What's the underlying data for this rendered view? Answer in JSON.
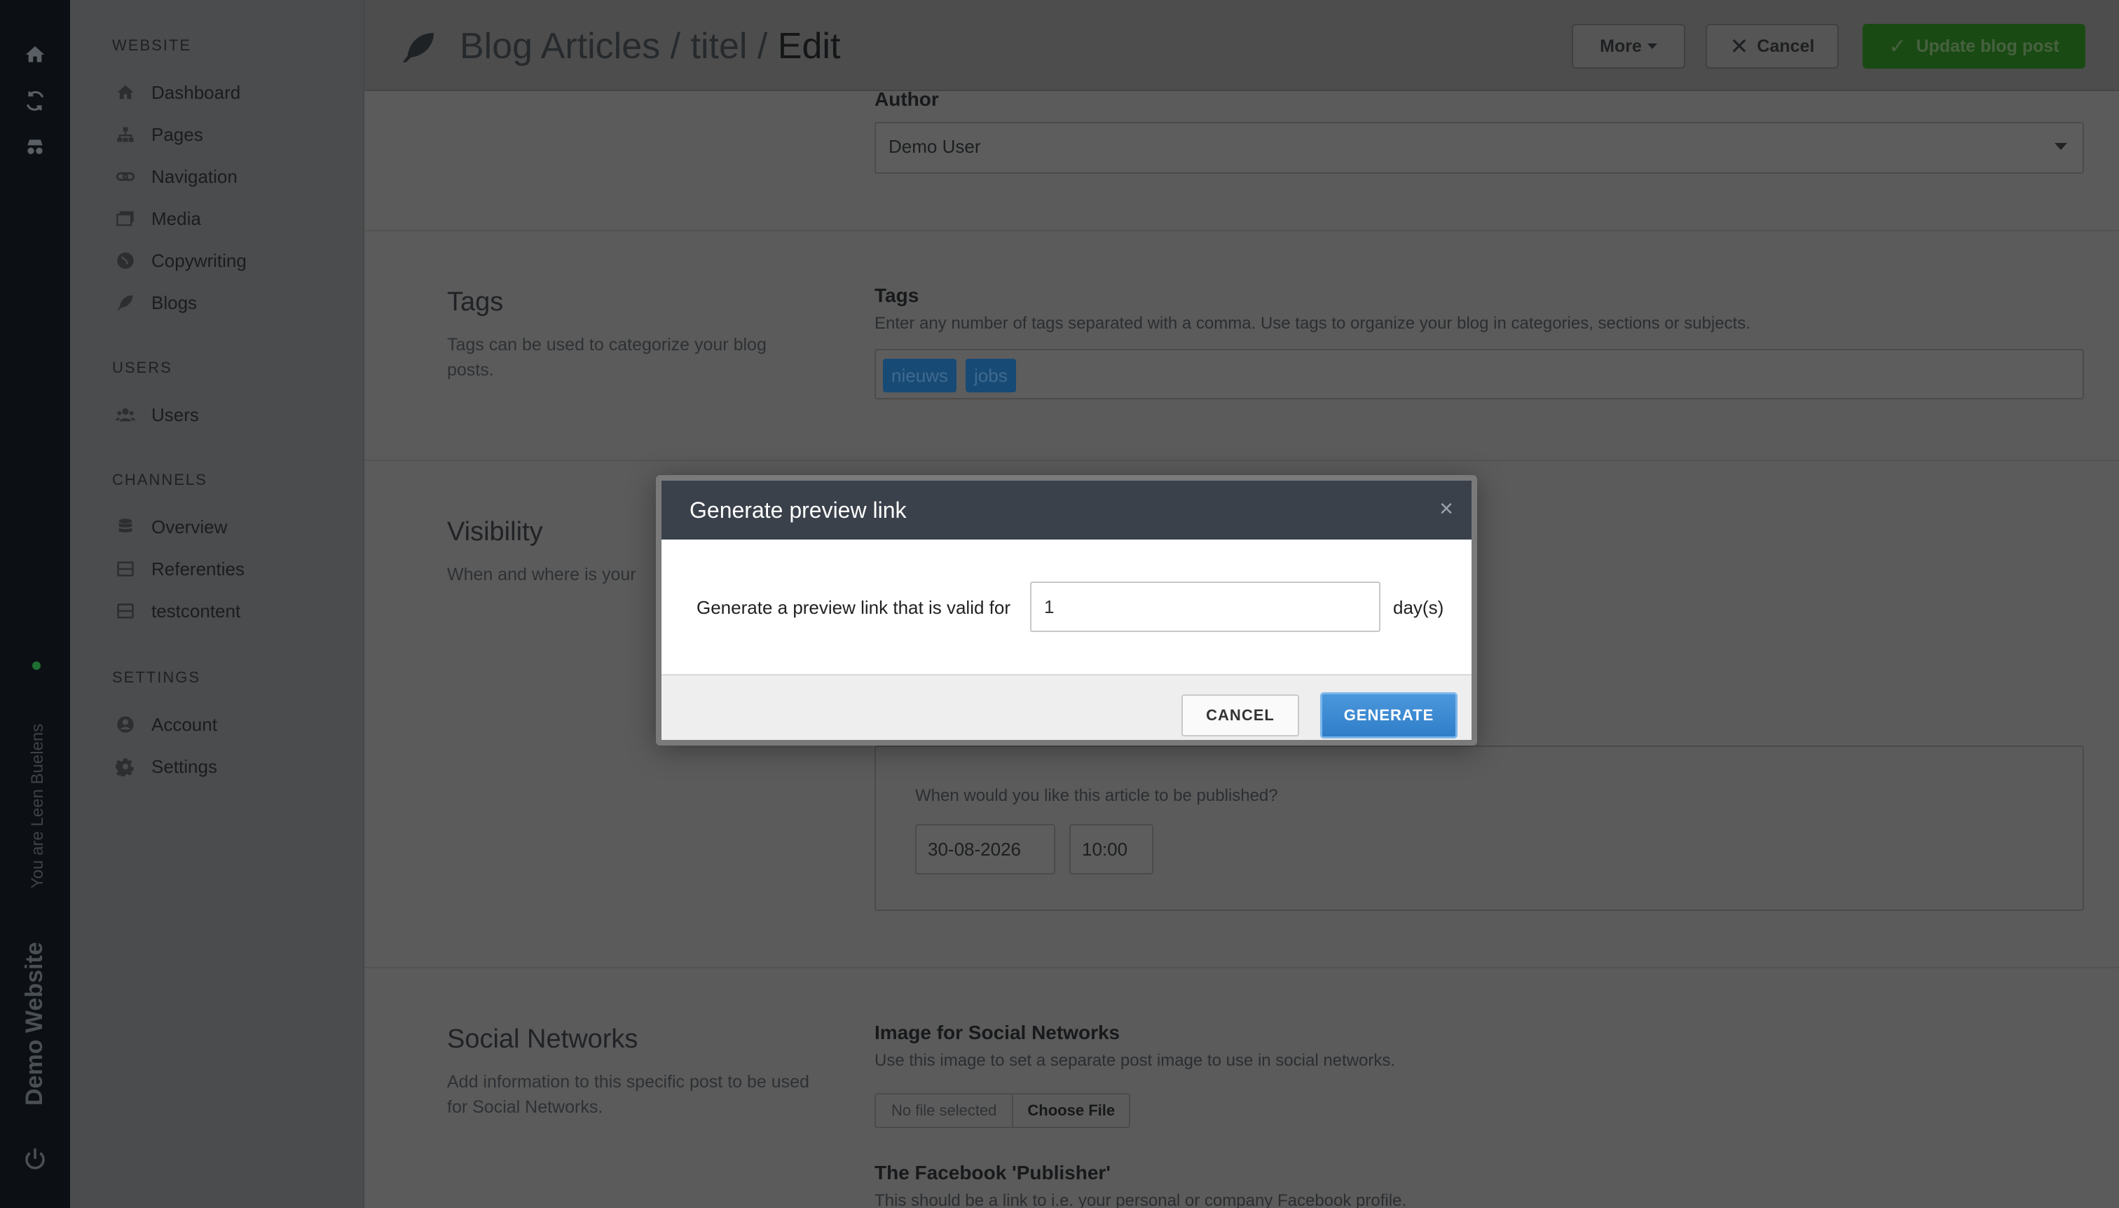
{
  "rail": {
    "user_text": "You are Leen Buelens",
    "site_name": "Demo Website"
  },
  "sidebar": {
    "sections": [
      {
        "title": "WEBSITE",
        "items": [
          "Dashboard",
          "Pages",
          "Navigation",
          "Media",
          "Copywriting",
          "Blogs"
        ]
      },
      {
        "title": "USERS",
        "items": [
          "Users"
        ]
      },
      {
        "title": "CHANNELS",
        "items": [
          "Overview",
          "Referenties",
          "testcontent"
        ]
      },
      {
        "title": "SETTINGS",
        "items": [
          "Account",
          "Settings"
        ]
      }
    ]
  },
  "header": {
    "crumb1": "Blog Articles",
    "sep": "/",
    "crumb2": "titel",
    "crumb3": "Edit",
    "more_label": "More",
    "cancel_label": "Cancel",
    "update_label": "Update blog post"
  },
  "author": {
    "label": "Author",
    "value": "Demo User"
  },
  "tags": {
    "title": "Tags",
    "desc": "Tags can be used to categorize your blog posts.",
    "label": "Tags",
    "help": "Enter any number of tags separated with a comma. Use tags to organize your blog in categories, sections or subjects.",
    "items": [
      "nieuws",
      "jobs"
    ]
  },
  "visibility": {
    "title": "Visibility",
    "desc": "When and where is your",
    "publish_question": "When would you like this article to be published?",
    "date": "30-08-2026",
    "time": "10:00"
  },
  "social": {
    "title": "Social Networks",
    "desc": "Add information to this specific post to be used for Social Networks.",
    "image_label": "Image for Social Networks",
    "image_help": "Use this image to set a separate post image to use in social networks.",
    "file_none": "No file selected",
    "file_btn": "Choose File",
    "fb_label": "The Facebook 'Publisher'",
    "fb_help": "This should be a link to i.e. your personal or company Facebook profile."
  },
  "modal": {
    "title": "Generate preview link",
    "close": "×",
    "text": "Generate a preview link that is valid for",
    "value": "1",
    "unit": "day(s)",
    "cancel": "CANCEL",
    "generate": "GENERATE"
  },
  "colors": {
    "accent_green": "#2e8b1f",
    "accent_blue": "#3a8ad6",
    "modal_header": "#3b414b"
  }
}
